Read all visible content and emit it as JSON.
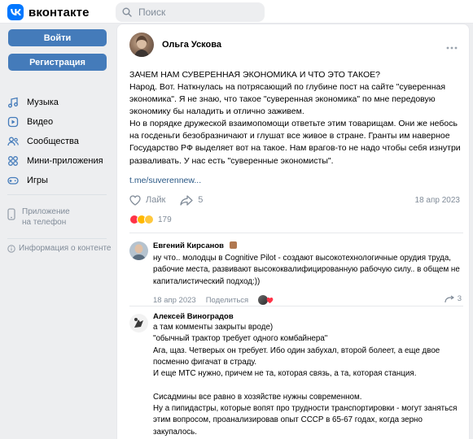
{
  "header": {
    "logo_text": "вконтакте",
    "search_placeholder": "Поиск"
  },
  "sidebar": {
    "login_label": "Войти",
    "register_label": "Регистрация",
    "items": [
      {
        "label": "Музыка",
        "icon": "music-icon"
      },
      {
        "label": "Видео",
        "icon": "video-icon"
      },
      {
        "label": "Сообщества",
        "icon": "communities-icon"
      },
      {
        "label": "Мини-приложения",
        "icon": "mini-apps-icon"
      },
      {
        "label": "Игры",
        "icon": "games-icon"
      }
    ],
    "app_promo_line1": "Приложение",
    "app_promo_line2": "на телефон",
    "info_label": "Информация о контенте"
  },
  "post": {
    "author": "Ольга Ускова",
    "title": "ЗАЧЕМ НАМ СУВЕРЕННАЯ ЭКОНОМИКА И ЧТО ЭТО ТАКОЕ?",
    "text": "Народ. Вот. Наткнулась на потрясающий по глубине пост на сайте \"суверенная экономика\". Я не знаю, что такое \"суверенная экономика\" по мне передовую экономику бы наладить и отлично заживем.\nНо в порядке дружеской взаимопомощи ответьте этим товарищам. Они же небось на госденьги безобразничают и глушат все живое в стране. Гранты им наверное Государство РФ выделяет вот на такое. Нам врагов-то не надо чтобы себя изнутри разваливать. У нас есть \"суверенные экономисты\".",
    "link": "t.me/suverennew...",
    "like_label": "Лайк",
    "share_count": "5",
    "date": "18 апр 2023",
    "reactions_count": "179",
    "reaction_colors": [
      "#ff3347",
      "#ffb800",
      "#ffc83d"
    ]
  },
  "comments": [
    {
      "name": "Евгений Кирсанов",
      "text": "ну что.. молодцы в Cognitive Pilot - создают высокотехнологичные орудия труда, рабочие места, развивают высококвалифицированную рабочую силу.. в общем не капиталистический подход:))",
      "date": "18 апр 2023",
      "share_label": "Поделиться",
      "replies_count": "3"
    },
    {
      "name": "Алексей Виноградов",
      "text": "а там комменты закрыты вроде)\n\"обычный трактор требует одного комбайнера\"\nАга, щаз. Четверых он требует. Ибо один забухал, второй болеет, а еще двое посменно фигачат в страду.\nИ еще МТС нужно, причем не та, которая связь, а та, которая станция.\n\nСисадмины все равно в хозяйстве нужны современном.\nНу а пипидастры, которые вопят про трудности транспортировки - могут заняться этим вопросом, проанализировав опыт СССР в 65-67 годах, когда зерно закупалось."
    }
  ]
}
